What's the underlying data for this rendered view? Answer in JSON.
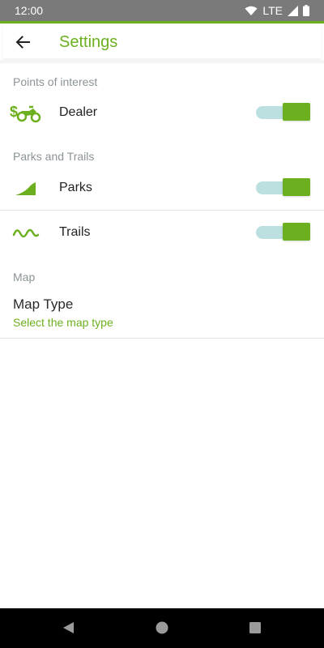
{
  "status_bar": {
    "time": "12:00",
    "network": "LTE"
  },
  "app_bar": {
    "title": "Settings",
    "back_icon": "arrow-left-icon"
  },
  "sections": {
    "points_of_interest": "Points of interest",
    "parks_and_trails": "Parks and Trails",
    "map": "Map"
  },
  "rows": {
    "dealer": {
      "label": "Dealer",
      "icon": "dealer-motorcycle-icon",
      "enabled": true
    },
    "parks": {
      "label": "Parks",
      "icon": "parks-icon",
      "enabled": true
    },
    "trails": {
      "label": "Trails",
      "icon": "trails-icon",
      "enabled": true
    }
  },
  "map_type": {
    "title": "Map Type",
    "subtitle": "Select the map type"
  },
  "colors": {
    "accent": "#6cb01f",
    "track": "#bcdfe0",
    "status_bar": "#7a7a7a"
  }
}
